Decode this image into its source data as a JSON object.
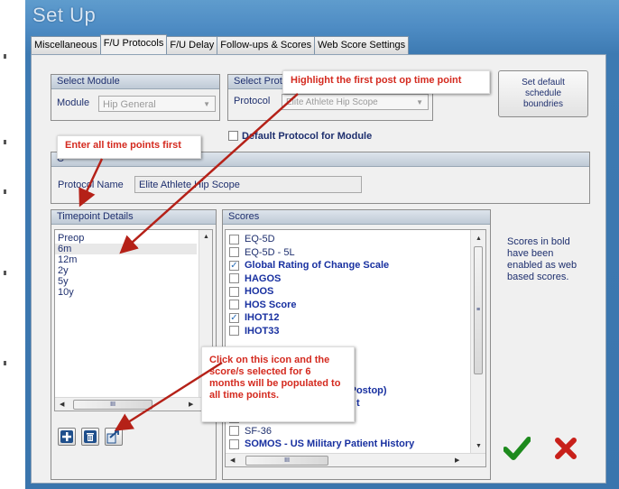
{
  "window": {
    "title": "Set Up"
  },
  "tabs": [
    {
      "label": "Miscellaneous",
      "active": false
    },
    {
      "label": "F/U Protocols",
      "active": true
    },
    {
      "label": "F/U Delay",
      "active": false
    },
    {
      "label": "Follow-ups & Scores",
      "active": false
    },
    {
      "label": "Web Score Settings",
      "active": false
    }
  ],
  "select_module": {
    "heading": "Select Module",
    "label": "Module",
    "value": "Hip General"
  },
  "select_protocol": {
    "heading": "Select Prot",
    "label": "Protocol",
    "value": "Elite Athlete Hip Scope"
  },
  "set_default_button": "Set default schedule boundries",
  "default_protocol_checkbox": {
    "label": "Default Protocol for Module",
    "checked": false
  },
  "protocol_group": {
    "heading": "C",
    "label": "Protocol Name",
    "value": "Elite Athlete Hip Scope"
  },
  "timepoint": {
    "heading": "Timepoint Details",
    "items": [
      "Preop",
      "6m",
      "12m",
      "2y",
      "5y",
      "10y"
    ],
    "selected_index": 1,
    "scroll_label": "III"
  },
  "scores": {
    "heading": "Scores",
    "items": [
      {
        "label": "EQ-5D",
        "checked": false,
        "bold": false
      },
      {
        "label": "EQ-5D - 5L",
        "checked": false,
        "bold": false
      },
      {
        "label": "Global Rating of Change Scale",
        "checked": true,
        "bold": true
      },
      {
        "label": "HAGOS",
        "checked": false,
        "bold": true
      },
      {
        "label": "HOOS",
        "checked": false,
        "bold": true
      },
      {
        "label": "HOS Score",
        "checked": false,
        "bold": true
      },
      {
        "label": "IHOT12",
        "checked": true,
        "bold": true
      },
      {
        "label": "IHOT33",
        "checked": false,
        "bold": true
      }
    ],
    "hidden_fragment_1": "ain (Postop)",
    "hidden_fragment_2": "t",
    "bottom_items": [
      {
        "label": "SF-12",
        "checked": false,
        "bold": false
      },
      {
        "label": "SF-36",
        "checked": false,
        "bold": false
      },
      {
        "label": "SOMOS - US Military Patient History",
        "checked": false,
        "bold": true
      }
    ],
    "scroll_label": "III"
  },
  "side_note": "Scores in bold have been enabled as web based scores.",
  "callouts": {
    "highlight": "Highlight the first post op time point",
    "enter_all": "Enter all time points first",
    "click_icon": "Click on this icon and the score/s selected for 6 months will be populated to all time points."
  },
  "icons": [
    "add-icon",
    "delete-icon",
    "copy-to-all-icon",
    "confirm-check-icon",
    "cancel-x-icon"
  ],
  "colors": {
    "window_blue": "#4e8cc4",
    "callout_red": "#d42a1f",
    "confirm_green": "#1d8a1d",
    "cancel_red": "#c8201a"
  }
}
